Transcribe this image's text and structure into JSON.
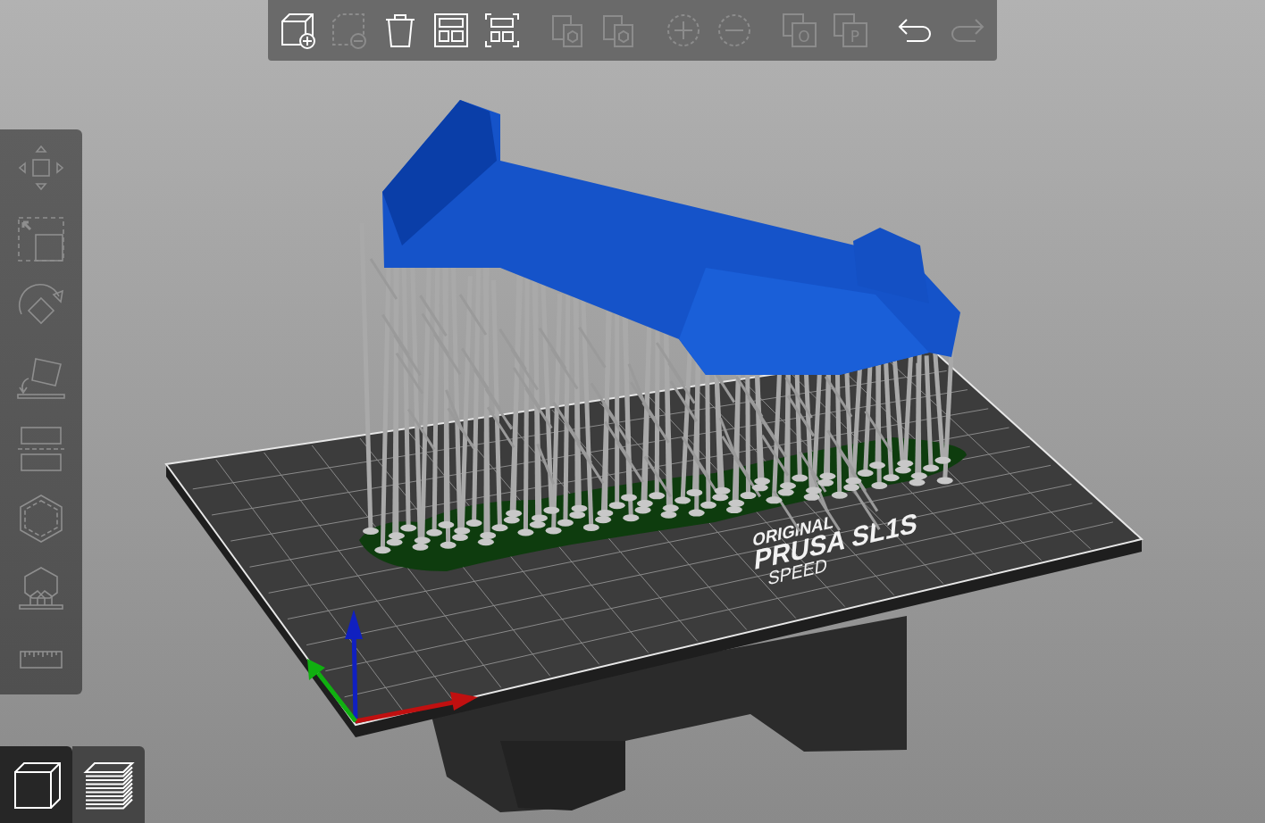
{
  "toolbar": {
    "groups": [
      [
        {
          "kind": "add",
          "disabled": false
        },
        {
          "kind": "delete",
          "disabled": true
        },
        {
          "kind": "delete_all",
          "disabled": false
        },
        {
          "kind": "arrange",
          "disabled": false
        },
        {
          "kind": "arrange_selection",
          "disabled": false
        }
      ],
      [
        {
          "kind": "copy",
          "disabled": true
        },
        {
          "kind": "paste",
          "disabled": true
        }
      ],
      [
        {
          "kind": "increase",
          "disabled": true
        },
        {
          "kind": "decrease",
          "disabled": true
        }
      ],
      [
        {
          "kind": "split_objects",
          "disabled": true,
          "glyph": "O"
        },
        {
          "kind": "split_parts",
          "disabled": true,
          "glyph": "P"
        }
      ],
      [
        {
          "kind": "undo",
          "disabled": false
        },
        {
          "kind": "redo",
          "disabled": true
        }
      ]
    ]
  },
  "sidebar": {
    "tools": [
      {
        "kind": "move",
        "disabled": true
      },
      {
        "kind": "scale",
        "disabled": true
      },
      {
        "kind": "rotate",
        "disabled": true
      },
      {
        "kind": "place_on_face",
        "disabled": true
      },
      {
        "kind": "cut",
        "disabled": true
      },
      {
        "kind": "hollow",
        "disabled": true
      },
      {
        "kind": "supports",
        "disabled": true
      },
      {
        "kind": "measure",
        "disabled": true
      }
    ]
  },
  "view_tabs": [
    {
      "kind": "model",
      "selected": true
    },
    {
      "kind": "preview",
      "selected": false
    }
  ],
  "bed_label": {
    "line_1": "ORIGINAL",
    "line_2": "PRUSA SL1S",
    "line_3": "SPEED"
  }
}
